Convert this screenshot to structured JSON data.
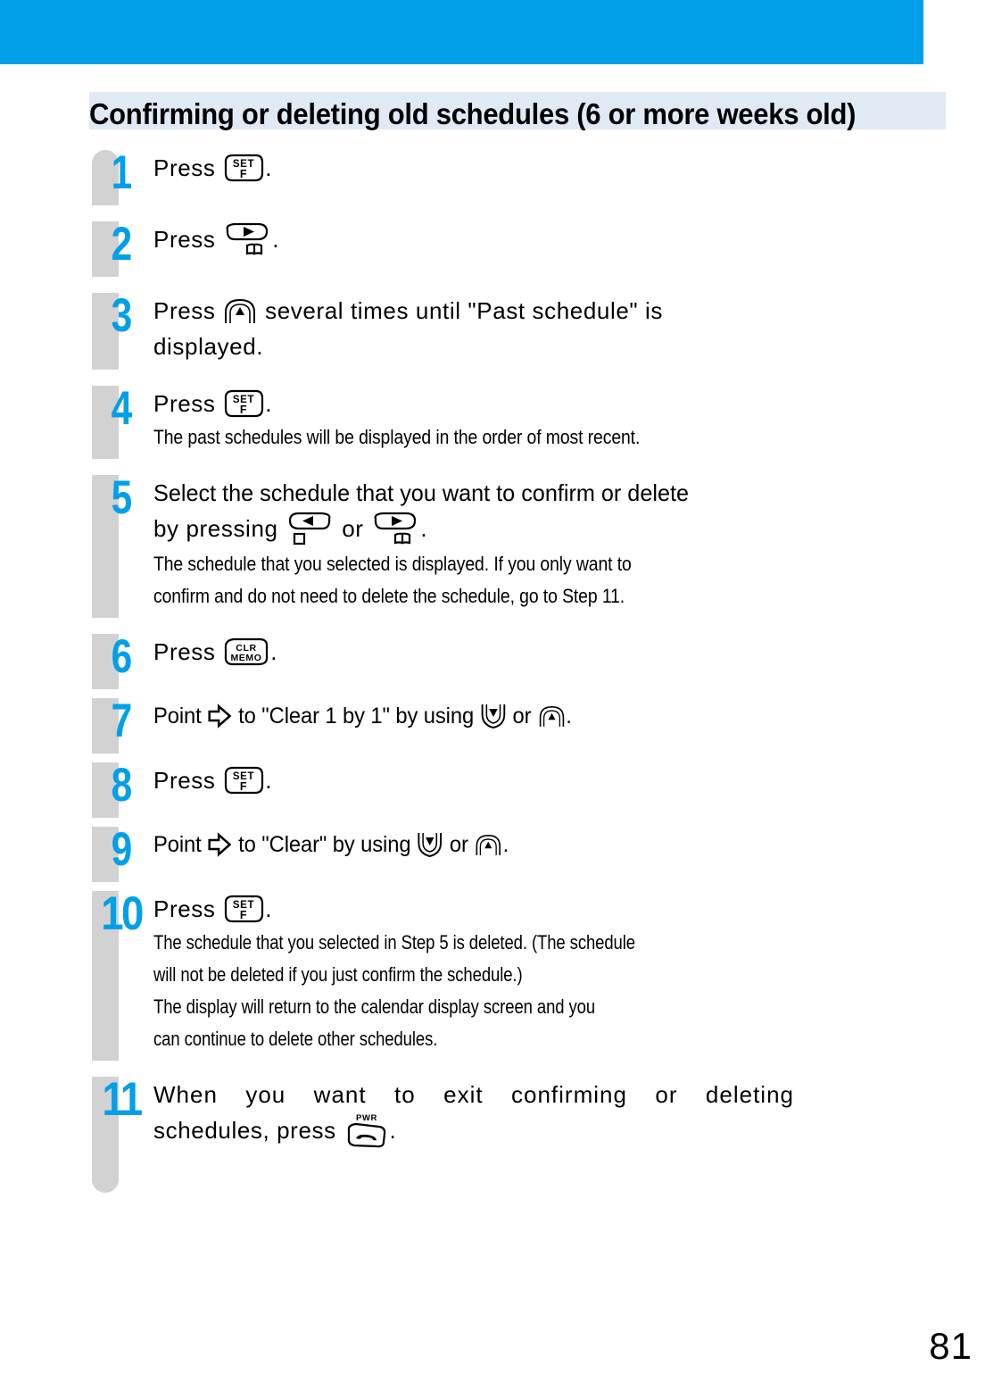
{
  "document": {
    "page_number": "81",
    "banner_color": "#00a0e9",
    "heading_band_color": "#dfeaf5",
    "rail_color": "#d2d2d2",
    "number_color": "#00a0e9",
    "title": "Confirming or deleting old schedules (6 or more weeks old)"
  },
  "steps": [
    {
      "number": "1",
      "main_prefix": "Press ",
      "main_suffix": ".",
      "key": "set-f-key",
      "notes": []
    },
    {
      "number": "2",
      "main_prefix": "Press ",
      "main_suffix": ".",
      "key": "right-arrow-book-key",
      "notes": []
    },
    {
      "number": "3",
      "main_prefix": "Press ",
      "main_mid": " several times until \"Past schedule\" is",
      "main_line2": "displayed.",
      "key": "up-arrow-key",
      "notes": []
    },
    {
      "number": "4",
      "main_prefix": "Press ",
      "main_suffix": ".",
      "key": "set-f-key",
      "notes": [
        "The past schedules will be displayed in the order of most recent."
      ]
    },
    {
      "number": "5",
      "main_line1": "Select the schedule that you want to confirm or delete",
      "main_line2_a": "by pressing ",
      "main_line2_b": " or ",
      "main_line2_c": ".",
      "key_left": "left-arrow-card-key",
      "key_right": "right-arrow-book-key",
      "notes": [
        "The schedule that you selected is displayed. If you only want to",
        "confirm and do not need to delete the schedule, go to Step 11."
      ]
    },
    {
      "number": "6",
      "main_prefix": "Press ",
      "main_suffix": ".",
      "key": "clr-memo-key",
      "notes": []
    },
    {
      "number": "7",
      "main_a": "Point ",
      "main_b": " to \"Clear 1 by 1\" by using ",
      "main_c": " or ",
      "main_d": ".",
      "key_pointer": "pointer-arrow-icon",
      "key_down": "down-arrow-key",
      "key_up": "up-arrow-key",
      "notes": []
    },
    {
      "number": "8",
      "main_prefix": "Press ",
      "main_suffix": ".",
      "key": "set-f-key",
      "notes": []
    },
    {
      "number": "9",
      "main_a": "Point ",
      "main_b": " to \"Clear\" by using ",
      "main_c": " or ",
      "main_d": ".",
      "key_pointer": "pointer-arrow-icon",
      "key_down": "down-arrow-key",
      "key_up": "up-arrow-key",
      "notes": []
    },
    {
      "number": "10",
      "main_prefix": "Press ",
      "main_suffix": ".",
      "key": "set-f-key",
      "notes": [
        "The schedule that you selected in Step 5 is deleted. (The schedule",
        "will not be deleted if you just confirm the schedule.)",
        "The display will return to the calendar display screen and you",
        "can continue to delete other schedules."
      ]
    },
    {
      "number": "11",
      "main_line1": "When you want to exit confirming or deleting",
      "main_line2_a": "schedules, press ",
      "main_line2_c": ".",
      "key_power": "power-key",
      "notes": []
    }
  ],
  "key_labels": {
    "set": "SET",
    "f": "F",
    "clr": "CLR",
    "memo": "MEMO",
    "pwr": "PWR"
  }
}
